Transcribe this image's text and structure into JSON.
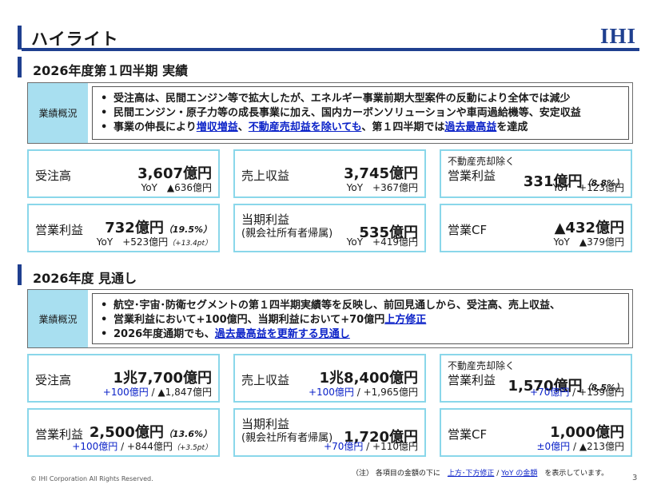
{
  "header": {
    "title": "ハイライト",
    "logo": "IHI"
  },
  "q1": {
    "heading": "2026年度第１四半期 実績",
    "summary_label": "業績概況",
    "bullet1": "受注高は、民間エンジン等で拡大したが、エネルギー事業前期大型案件の反動により全体では減少",
    "bullet2_line1": "民間エンジン・原子力等の成長事業に加え、国内カーボンソリューションや車両過給機等、安定収益",
    "bullet2_a": "事業の伸長により",
    "bullet2_hl1": "増収増益",
    "bullet2_b": "、",
    "bullet2_hl2": "不動産売却益を除いても",
    "bullet2_c": "、第１四半期では",
    "bullet2_hl3": "過去最高益",
    "bullet2_d": "を達成",
    "cards": {
      "orders": {
        "label": "受注高",
        "value": "3,607億円",
        "sub": "YoY　▲636億円"
      },
      "revenue": {
        "label": "売上収益",
        "value": "3,745億円",
        "sub": "YoY　+367億円"
      },
      "op_ex": {
        "pre": "不動産売却除く",
        "label": "営業利益",
        "value": "331億円",
        "pct": "（8.8%）",
        "sub": "YoY　+123億円"
      },
      "op": {
        "label": "営業利益",
        "value": "732億円",
        "pct": "（19.5%）",
        "sub": "YoY　+523億円",
        "sub_small": "（+13.4pt）"
      },
      "net": {
        "label1": "当期利益",
        "label2": "(親会社所有者帰属)",
        "value": "535億円",
        "sub": "YoY　+419億円"
      },
      "cf": {
        "label": "営業CF",
        "value": "▲432億円",
        "sub": "YoY　▲379億円"
      }
    }
  },
  "fy": {
    "heading": "2026年度 見通し",
    "summary_label": "業績概況",
    "bullet1_line1": "航空･宇宙･防衛セグメントの第１四半期実績等を反映し、前回見通しから、受注高、売上収益、",
    "bullet1_a": "営業利益において+100億円、当期利益において+70億円",
    "bullet1_hl": "上方修正",
    "bullet2_a": "2026年度通期でも、",
    "bullet2_hl": "過去最高益を更新する見通し",
    "cards": {
      "orders": {
        "label": "受注高",
        "value": "1兆7,700億円",
        "sub_blue": "+100億円",
        "sub_rest": " / ▲1,847億円"
      },
      "revenue": {
        "label": "売上収益",
        "value": "1兆8,400億円",
        "sub_blue": "+100億円",
        "sub_rest": " / +1,965億円"
      },
      "op_ex": {
        "pre": "不動産売却除く",
        "label": "営業利益",
        "value": "1,570億円",
        "pct": "（8.5%）",
        "sub_blue": "+70億円",
        "sub_rest": " / +139億円"
      },
      "op": {
        "label": "営業利益",
        "value": "2,500億円",
        "pct": "（13.6%）",
        "sub_blue": "+100億円",
        "sub_rest": " / +844億円",
        "sub_small": "（+3.5pt）"
      },
      "net": {
        "label1": "当期利益",
        "label2": "(親会社所有者帰属)",
        "value": "1,720億円",
        "sub_blue": "+70億円",
        "sub_rest": " / +110億円"
      },
      "cf": {
        "label": "営業CF",
        "value": "1,000億円",
        "sub_blue": "±0億円",
        "sub_rest": " / ▲213億円"
      }
    }
  },
  "footer": {
    "note_a": "（注） 各項目の金額の下に　",
    "note_hl1": "上方･下方修正",
    "note_b": " / ",
    "note_hl2": "YoY の金額",
    "note_c": "　を表示しています。",
    "copyright": "© IHI Corporation All Rights Reserved.",
    "page": "3"
  }
}
